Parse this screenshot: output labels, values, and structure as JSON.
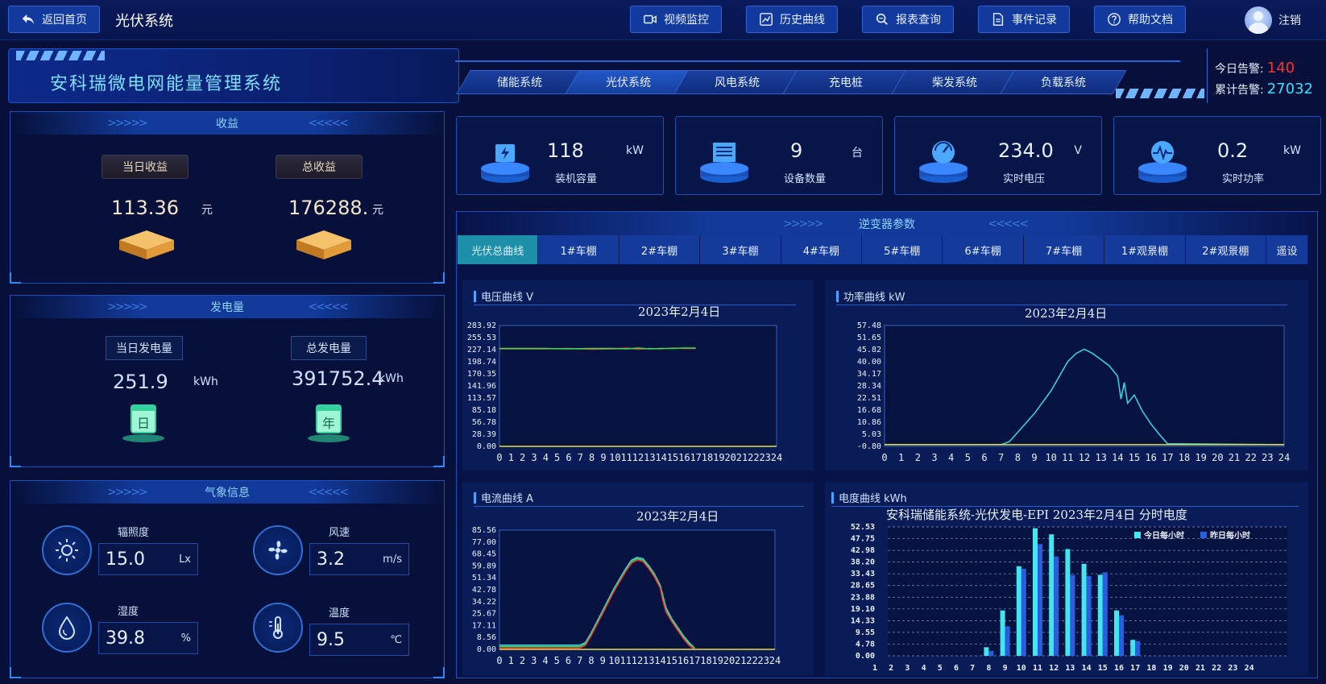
{
  "topbar": {
    "home_label": "返回首页",
    "page_title": "光伏系统",
    "buttons": [
      {
        "label": "视频监控",
        "icon": "video-icon"
      },
      {
        "label": "历史曲线",
        "icon": "trend-icon"
      },
      {
        "label": "报表查询",
        "icon": "search-icon"
      },
      {
        "label": "事件记录",
        "icon": "document-icon"
      },
      {
        "label": "帮助文档",
        "icon": "help-icon"
      }
    ],
    "logout_label": "注销"
  },
  "banner": {
    "title": "安科瑞微电网能量管理系统",
    "subtabs": [
      "储能系统",
      "光伏系统",
      "风电系统",
      "充电桩",
      "柴发系统",
      "负载系统"
    ],
    "alarm_today_label": "今日告警:",
    "alarm_today_value": "140",
    "alarm_total_label": "累计告警:",
    "alarm_total_value": "27032"
  },
  "revenue": {
    "title": "收益",
    "today_label": "当日收益",
    "today_value": "113.36",
    "today_unit": "元",
    "total_label": "总收益",
    "total_value": "176288.",
    "total_unit": "元"
  },
  "generation": {
    "title": "发电量",
    "today_label": "当日发电量",
    "today_value": "251.9",
    "today_unit": "kWh",
    "today_badge": "日",
    "total_label": "总发电量",
    "total_value": "391752.4",
    "total_unit": "kWh",
    "total_badge": "年"
  },
  "weather": {
    "title": "气象信息",
    "items": [
      {
        "label": "辐照度",
        "value": "15.0",
        "unit": "Lx",
        "icon": "sun-icon"
      },
      {
        "label": "风速",
        "value": "3.2",
        "unit": "m/s",
        "icon": "fan-icon"
      },
      {
        "label": "湿度",
        "value": "39.8",
        "unit": "%",
        "icon": "droplet-icon"
      },
      {
        "label": "温度",
        "value": "9.5",
        "unit": "℃",
        "icon": "thermometer-icon"
      }
    ]
  },
  "kpis": [
    {
      "value": "118",
      "unit": "kW",
      "label": "装机容量",
      "icon": "battery-icon"
    },
    {
      "value": "9",
      "unit": "台",
      "label": "设备数量",
      "icon": "device-icon"
    },
    {
      "value": "234.0",
      "unit": "V",
      "label": "实时电压",
      "icon": "gauge-icon"
    },
    {
      "value": "0.2",
      "unit": "kW",
      "label": "实时功率",
      "icon": "pulse-icon"
    }
  ],
  "inverter": {
    "title": "逆变器参数",
    "tabs": [
      "光伏总曲线",
      "1#车棚",
      "2#车棚",
      "3#车棚",
      "4#车棚",
      "5#车棚",
      "6#车棚",
      "7#车棚",
      "1#观景棚",
      "2#观景棚",
      "遥设"
    ],
    "active_tab": 0
  },
  "colors": {
    "accent": "#2e64d6",
    "tab_active": "#1e8fa8",
    "alarm_red": "#ff3030",
    "alarm_cyan": "#35e0ff",
    "curve_cyan": "#35d8e8",
    "bar_today": "#43e6f0",
    "bar_yesterday": "#2a5ee0"
  },
  "chart_data": [
    {
      "type": "line",
      "panel_title": "电压曲线 V",
      "title": "2023年2月4日",
      "yticks": [
        "283.92",
        "255.53",
        "227.14",
        "198.74",
        "170.35",
        "141.96",
        "113.57",
        "85.18",
        "56.78",
        "28.39",
        "0.00"
      ],
      "ylim": [
        0,
        283.92
      ],
      "xticks": [
        "0",
        "1",
        "2",
        "3",
        "4",
        "5",
        "6",
        "7",
        "8",
        "9",
        "10",
        "11",
        "12",
        "13",
        "14",
        "15",
        "16",
        "17",
        "18",
        "19",
        "20",
        "21",
        "22",
        "23",
        "24"
      ],
      "xlim": [
        0,
        24
      ],
      "series": [
        {
          "color": "#ff3030",
          "x": [
            0,
            2,
            4,
            6,
            8,
            10,
            11,
            12,
            13,
            14,
            15,
            16,
            17
          ],
          "y": [
            229,
            229,
            229,
            230,
            228,
            229,
            231,
            228,
            230,
            229,
            231,
            230,
            230
          ]
        },
        {
          "color": "#33dd55",
          "x": [
            0,
            2,
            4,
            6,
            8,
            10,
            11,
            12,
            13,
            14,
            15,
            16,
            17
          ],
          "y": [
            230,
            230,
            230,
            229,
            230,
            230,
            229,
            231,
            229,
            230,
            230,
            231,
            231
          ]
        },
        {
          "color": "#e8e040",
          "x": [
            0,
            24
          ],
          "y": [
            0,
            0
          ]
        }
      ]
    },
    {
      "type": "line",
      "panel_title": "功率曲线 kW",
      "title": "2023年2月4日",
      "yticks": [
        "57.48",
        "51.65",
        "45.82",
        "40.00",
        "34.17",
        "28.34",
        "22.51",
        "16.68",
        "10.86",
        "5.03",
        "-0.80"
      ],
      "ylim": [
        -0.8,
        57.48
      ],
      "xticks": [
        "0",
        "1",
        "2",
        "3",
        "4",
        "5",
        "6",
        "7",
        "8",
        "9",
        "10",
        "11",
        "12",
        "13",
        "14",
        "15",
        "16",
        "17",
        "18",
        "19",
        "20",
        "21",
        "22",
        "23",
        "24"
      ],
      "xlim": [
        0,
        24
      ],
      "series": [
        {
          "color": "#35d8e8",
          "x": [
            0,
            7,
            7.5,
            8,
            9,
            10,
            10.5,
            11,
            11.5,
            12,
            12.5,
            13,
            13.5,
            14,
            14.2,
            14.4,
            14.6,
            15,
            15.5,
            16,
            16.5,
            17,
            24
          ],
          "y": [
            0,
            0,
            1.5,
            6,
            15,
            26,
            33,
            40,
            44,
            46,
            44,
            41,
            38,
            33,
            22,
            30,
            20,
            24,
            16,
            10,
            5,
            0.5,
            0
          ]
        },
        {
          "color": "#e8e040",
          "x": [
            0,
            24
          ],
          "y": [
            0,
            0
          ]
        }
      ]
    },
    {
      "type": "line",
      "panel_title": "电流曲线 A",
      "title": "2023年2月4日",
      "yticks": [
        "85.56",
        "77.00",
        "68.45",
        "59.89",
        "51.34",
        "42.78",
        "34.22",
        "25.67",
        "17.11",
        "8.56",
        "0.00"
      ],
      "ylim": [
        0,
        85.56
      ],
      "xticks": [
        "0",
        "1",
        "2",
        "3",
        "4",
        "5",
        "6",
        "7",
        "8",
        "9",
        "10",
        "11",
        "12",
        "13",
        "14",
        "15",
        "16",
        "17",
        "18",
        "19",
        "20",
        "21",
        "22",
        "23",
        "24"
      ],
      "xlim": [
        0,
        24
      ],
      "series": [
        {
          "color": "#35d8e8",
          "x": [
            0,
            7,
            7.5,
            8,
            9,
            10,
            11,
            11.5,
            12,
            12.5,
            13,
            13.5,
            14,
            14.5,
            15,
            15.5,
            16,
            16.5,
            17
          ],
          "y": [
            3,
            3,
            5,
            12,
            28,
            44,
            58,
            64,
            66,
            65,
            60,
            54,
            46,
            30,
            22,
            16,
            10,
            5,
            1
          ]
        },
        {
          "color": "#33dd55",
          "x": [
            0,
            7,
            7.5,
            8,
            9,
            10,
            11,
            11.5,
            12,
            12.5,
            13,
            13.5,
            14,
            14.5,
            15,
            15.5,
            16,
            16.5,
            17
          ],
          "y": [
            2,
            2,
            4,
            11,
            27,
            43,
            57,
            63,
            65,
            64,
            59,
            53,
            45,
            28,
            21,
            15,
            9,
            4,
            1
          ]
        },
        {
          "color": "#ff3030",
          "x": [
            0,
            7,
            7.5,
            8,
            9,
            10,
            11,
            11.5,
            12,
            12.5,
            13,
            13.5,
            14,
            14.2,
            14.5,
            15,
            15.5,
            16,
            16.5,
            17
          ],
          "y": [
            1,
            1,
            3,
            10,
            26,
            42,
            56,
            62,
            64,
            63,
            58,
            52,
            44,
            36,
            27,
            20,
            14,
            8,
            3,
            0
          ]
        },
        {
          "color": "#e8e040",
          "x": [
            0,
            24
          ],
          "y": [
            0,
            0
          ]
        }
      ]
    },
    {
      "type": "bar",
      "panel_title": "电度曲线 kWh",
      "title": "安科瑞储能系统-光伏发电-EPI 2023年2月4日 分时电度",
      "yticks": [
        "52.53",
        "47.75",
        "42.98",
        "38.20",
        "33.43",
        "28.65",
        "23.88",
        "19.10",
        "14.33",
        "9.55",
        "4.78",
        "0.00"
      ],
      "ylim": [
        0,
        52.53
      ],
      "categories": [
        "1",
        "2",
        "3",
        "4",
        "5",
        "6",
        "7",
        "8",
        "9",
        "10",
        "11",
        "12",
        "13",
        "14",
        "15",
        "16",
        "17",
        "18",
        "19",
        "20",
        "21",
        "22",
        "23",
        "24"
      ],
      "series": [
        {
          "name": "今日每小时",
          "values": [
            0,
            0,
            0,
            0,
            0,
            0,
            0,
            3.5,
            18.5,
            36.5,
            52.0,
            49.5,
            43.5,
            37.5,
            33.0,
            18.5,
            6.5,
            0,
            0,
            0,
            0,
            0,
            0,
            0
          ]
        },
        {
          "name": "昨日每小时",
          "values": [
            0,
            0,
            0,
            0,
            0,
            0,
            0,
            2.0,
            12.0,
            35.5,
            45.5,
            40.5,
            33.0,
            32.5,
            34.0,
            16.5,
            6.0,
            0,
            0,
            0,
            0,
            0,
            0,
            0
          ]
        }
      ]
    }
  ]
}
